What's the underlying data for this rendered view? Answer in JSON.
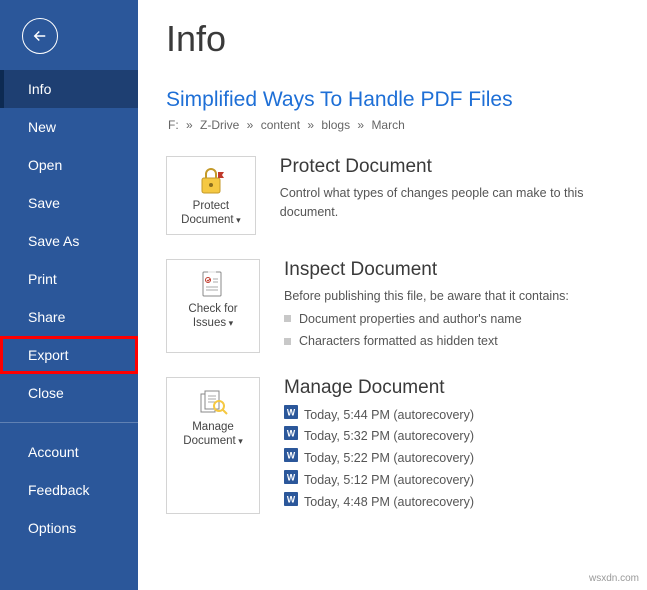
{
  "sidebar": {
    "items": [
      {
        "label": "Info",
        "selected": true
      },
      {
        "label": "New"
      },
      {
        "label": "Open"
      },
      {
        "label": "Save"
      },
      {
        "label": "Save As"
      },
      {
        "label": "Print"
      },
      {
        "label": "Share"
      },
      {
        "label": "Export",
        "highlight": true
      },
      {
        "label": "Close"
      }
    ],
    "footer": [
      {
        "label": "Account"
      },
      {
        "label": "Feedback"
      },
      {
        "label": "Options"
      }
    ]
  },
  "main": {
    "title": "Info",
    "docTitle": "Simplified Ways To Handle PDF Files",
    "breadcrumb": [
      "F:",
      "Z-Drive",
      "content",
      "blogs",
      "March"
    ],
    "protect": {
      "btn": "Protect Document",
      "heading": "Protect Document",
      "body": "Control what types of changes people can make to this document."
    },
    "inspect": {
      "btn": "Check for Issues",
      "heading": "Inspect Document",
      "body": "Before publishing this file, be aware that it contains:",
      "items": [
        "Document properties and author's name",
        "Characters formatted as hidden text"
      ]
    },
    "manage": {
      "btn": "Manage Document",
      "heading": "Manage Document",
      "versions": [
        "Today, 5:44 PM (autorecovery)",
        "Today, 5:32 PM (autorecovery)",
        "Today, 5:22 PM (autorecovery)",
        "Today, 5:12 PM (autorecovery)",
        "Today, 4:48 PM (autorecovery)"
      ]
    }
  },
  "watermark": "wsxdn.com"
}
